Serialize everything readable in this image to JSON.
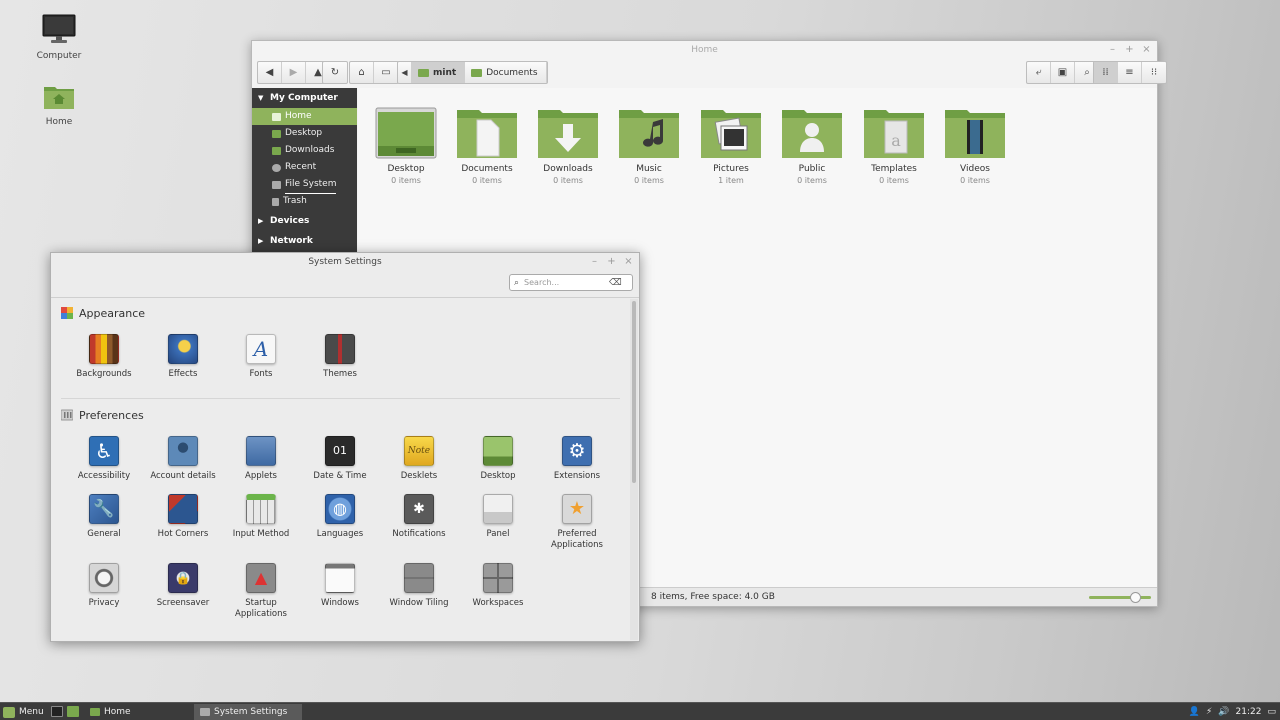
{
  "desktop": {
    "icons": [
      {
        "label": "Computer"
      },
      {
        "label": "Home"
      }
    ]
  },
  "file_manager": {
    "title": "Home",
    "breadcrumbs": [
      {
        "label": "mint"
      },
      {
        "label": "Documents"
      }
    ],
    "sidebar": {
      "sections": [
        {
          "label": "My Computer"
        },
        {
          "label": "Devices"
        },
        {
          "label": "Network"
        }
      ],
      "items": [
        {
          "label": "Home"
        },
        {
          "label": "Desktop"
        },
        {
          "label": "Downloads"
        },
        {
          "label": "Recent"
        },
        {
          "label": "File System"
        },
        {
          "label": "Trash"
        }
      ]
    },
    "folders": [
      {
        "name": "Desktop",
        "count": "0 items"
      },
      {
        "name": "Documents",
        "count": "0 items"
      },
      {
        "name": "Downloads",
        "count": "0 items"
      },
      {
        "name": "Music",
        "count": "0 items"
      },
      {
        "name": "Pictures",
        "count": "1 item"
      },
      {
        "name": "Public",
        "count": "0 items"
      },
      {
        "name": "Templates",
        "count": "0 items"
      },
      {
        "name": "Videos",
        "count": "0 items"
      }
    ],
    "status": "8 items, Free space: 4.0 GB",
    "zoom_level": 0.75
  },
  "settings": {
    "title": "System Settings",
    "search": {
      "placeholder": "Search..."
    },
    "sections": [
      {
        "title": "Appearance",
        "items": [
          {
            "label": "Backgrounds"
          },
          {
            "label": "Effects"
          },
          {
            "label": "Fonts"
          },
          {
            "label": "Themes"
          }
        ]
      },
      {
        "title": "Preferences",
        "items": [
          {
            "label": "Accessibility"
          },
          {
            "label": "Account details"
          },
          {
            "label": "Applets"
          },
          {
            "label": "Date & Time"
          },
          {
            "label": "Desklets"
          },
          {
            "label": "Desktop"
          },
          {
            "label": "Extensions"
          },
          {
            "label": "General"
          },
          {
            "label": "Hot Corners"
          },
          {
            "label": "Input Method"
          },
          {
            "label": "Languages"
          },
          {
            "label": "Notifications"
          },
          {
            "label": "Panel"
          },
          {
            "label": "Preferred Applications"
          },
          {
            "label": "Privacy"
          },
          {
            "label": "Screensaver"
          },
          {
            "label": "Startup Applications"
          },
          {
            "label": "Windows"
          },
          {
            "label": "Window Tiling"
          },
          {
            "label": "Workspaces"
          }
        ]
      }
    ]
  },
  "taskbar": {
    "menu_label": "Menu",
    "tasks": [
      {
        "label": "Home"
      },
      {
        "label": "System Settings"
      }
    ],
    "clock": "21:22"
  },
  "colors": {
    "accent": "#8fb35c",
    "folder_green": "#7aa84d",
    "sidebar_bg": "#3a3a3a",
    "taskbar_bg": "#3b3b3b"
  }
}
